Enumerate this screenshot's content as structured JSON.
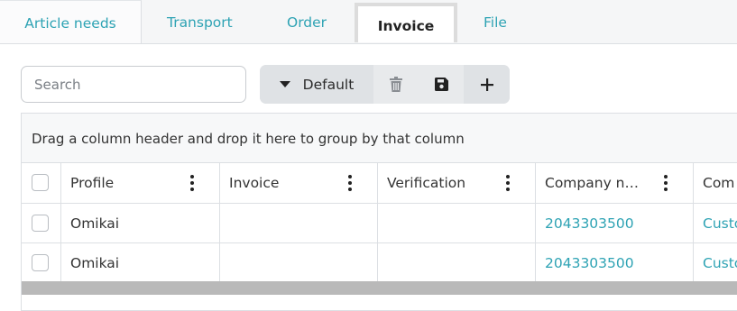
{
  "tabs": [
    {
      "label": "Article needs"
    },
    {
      "label": "Transport"
    },
    {
      "label": "Order"
    },
    {
      "label": "Invoice",
      "active": true
    },
    {
      "label": "File"
    }
  ],
  "toolbar": {
    "search_placeholder": "Search",
    "layout_label": "Default",
    "icons": [
      "caret-down-icon",
      "trash-icon",
      "save-icon",
      "plus-icon"
    ]
  },
  "grid": {
    "group_panel_text": "Drag a column header and drop it here to group by that column",
    "columns": [
      "Profile",
      "Invoice",
      "Verification",
      "Company n…",
      "Com"
    ],
    "rows": [
      {
        "profile": "Omikai",
        "invoice": "",
        "verification": "",
        "company_number": "2043303500",
        "company": "Custo"
      },
      {
        "profile": "Omikai",
        "invoice": "",
        "verification": "",
        "company_number": "2043303500",
        "company": "Custo"
      }
    ]
  },
  "colors": {
    "accent": "#2ea3b4",
    "text": "#333333",
    "border": "#dcdfe3",
    "toolbar_bg": "#e4e6e9"
  }
}
